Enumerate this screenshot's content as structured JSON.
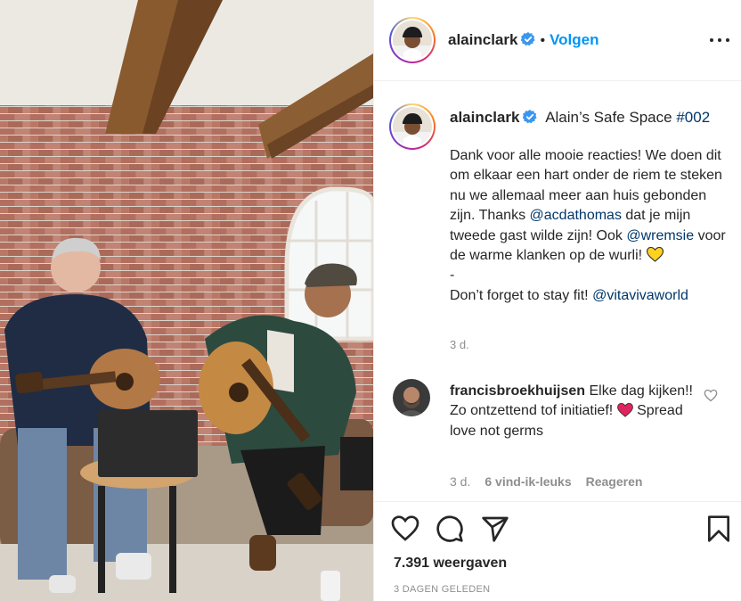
{
  "post": {
    "username": "alainclark",
    "follow_label": "Volgen",
    "separator": "•",
    "caption_title": "Alain’s Safe Space",
    "caption_hashtag": "#002",
    "caption_part1": "Dank voor alle mooie reacties! We doen dit om elkaar een hart onder de riem te steken nu we allemaal meer aan huis gebonden zijn. Thanks ",
    "mention1": "@acdathomas",
    "caption_part2": " dat je mijn tweede gast wilde zijn! Ook ",
    "mention2": "@wremsie",
    "caption_part3": " voor de warme klanken op de wurli! ",
    "dash": "-",
    "caption_part4": "Don’t forget to stay fit! ",
    "mention3": "@vitavivaworld",
    "caption_time": "3 d."
  },
  "comment": {
    "username": "francisbroekhuijsen",
    "text_part1": " Elke dag kijken!! Zo ontzettend tof initiatief! ",
    "text_part2": " Spread love not germs",
    "time": "3 d.",
    "likes": "6 vind-ik-leuks",
    "reply_label": "Reageren"
  },
  "footer": {
    "views": "7.391 weergaven",
    "posted": "3 DAGEN GELEDEN"
  },
  "icons": {
    "verified": "verified-badge-icon",
    "like": "heart-outline-icon",
    "comment": "comment-bubble-icon",
    "share": "paper-plane-icon",
    "save": "bookmark-icon",
    "more": "more-options-icon"
  },
  "colors": {
    "link": "#00376b",
    "follow": "#0095f6",
    "verified": "#3897f0",
    "meta": "#8e8e8e",
    "yellow_heart": "#ffd21f",
    "red_heart": "#e0245e"
  }
}
